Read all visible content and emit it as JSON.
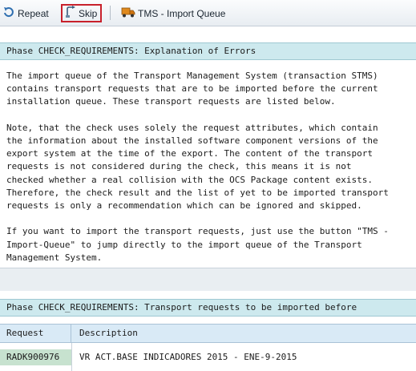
{
  "toolbar": {
    "repeat_label": "Repeat",
    "skip_label": "Skip",
    "tms_label": "TMS - Import Queue"
  },
  "phase_explanation": {
    "title": "Phase CHECK_REQUIREMENTS: Explanation of Errors",
    "paragraphs": [
      "The import queue of the Transport Management System (transaction STMS)\ncontains transport requests that are to be imported before the current\ninstallation queue. These transport requests are listed below.",
      "Note, that the check uses solely the request attributes, which contain\nthe information about the installed software component versions of the\nexport system at the time of the export. The content of the transport\nrequests is not considered during the check, this means it is not\nchecked whether a real collision with the OCS Package content exists.\nTherefore, the check result and the list of yet to be imported transport\nrequests is only a recommendation which can be ignored and skipped.",
      "If you want to import the transport requests, just use the button \"TMS -\nImport-Queue\" to jump directly to the import queue of the Transport\nManagement System."
    ]
  },
  "phase_requests": {
    "title": "Phase CHECK_REQUIREMENTS: Transport requests to be imported before"
  },
  "table": {
    "headers": {
      "request": "Request",
      "description": "Description"
    },
    "rows": [
      {
        "request": "RADK900976",
        "description": "VR ACT.BASE INDICADORES 2015 - ENE-9-2015"
      }
    ]
  }
}
